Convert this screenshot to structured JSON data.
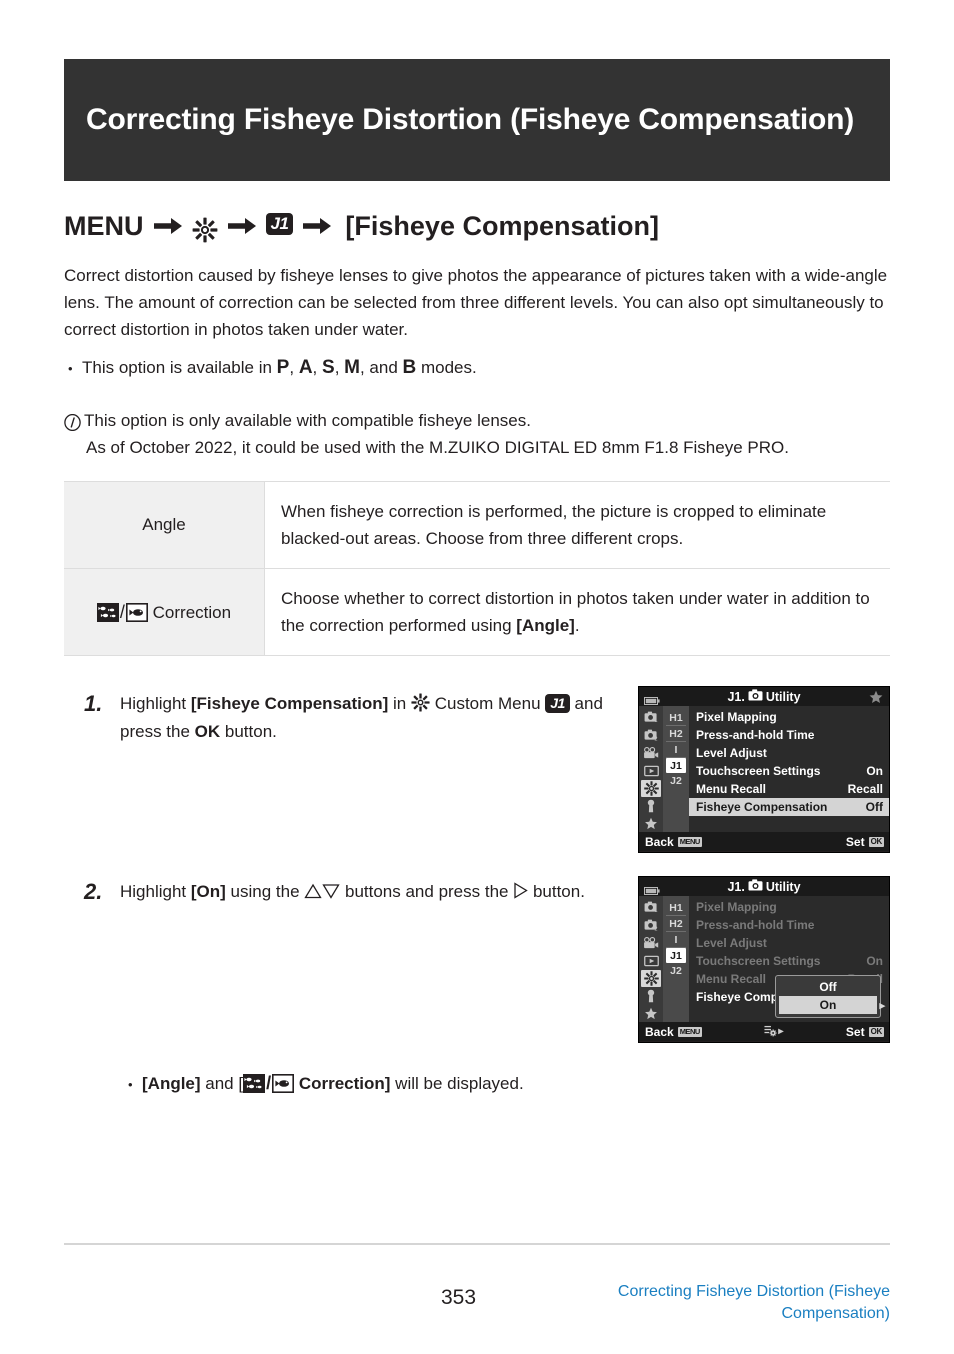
{
  "document": {
    "title": "Correcting Fisheye Distortion (Fisheye Compensation)",
    "page_number": "353"
  },
  "menu_path": {
    "menu_label": "MENU",
    "arrow": "→",
    "gear_icon": "gear-icon",
    "tab_badge": "J1",
    "target": "[Fisheye Compensation]"
  },
  "intro": {
    "paragraph": "Correct distortion caused by fisheye lenses to give photos the appearance of pictures taken with a wide-angle lens. The amount of correction can be selected from three different levels. You can also opt simultaneously to correct distortion in photos taken under water.",
    "bullet_prefix": "This option is available in ",
    "modes": [
      "P",
      "A",
      "S",
      "M",
      "B"
    ],
    "bullet_suffix": " modes.",
    "bullet_mid": ", and "
  },
  "note": {
    "icon": "info-icon",
    "line1": "This option is only available with compatible fisheye lenses.",
    "line2": "As of October 2022, it could be used with the M.ZUIKO DIGITAL ED 8mm F1.8 Fisheye PRO."
  },
  "table": {
    "rows": [
      {
        "label": "Angle",
        "has_icons": false,
        "description": "When fisheye correction is performed, the picture is cropped to eliminate blacked-out areas. Choose from three different crops."
      },
      {
        "label": "Correction",
        "has_icons": true,
        "icon_left": "fish-group-icon",
        "icon_right": "fish-underwater-icon",
        "description_pre": "Choose whether to correct distortion in photos taken under water in addition to the correction performed using ",
        "description_bold": "[Angle]",
        "description_post": "."
      }
    ]
  },
  "steps": [
    {
      "number": "1.",
      "text_parts": {
        "p1": "Highlight ",
        "b1": "[Fisheye Compensation]",
        "p2": " in ",
        "icon": "gear-icon",
        "p3": " Custom Menu ",
        "badge": "J1",
        "p4": " and press the ",
        "b2": "OK",
        "p5": " button."
      }
    },
    {
      "number": "2.",
      "text_parts": {
        "p1": "Highlight ",
        "b1": "[On]",
        "p2": " using the ",
        "icon_up": "triangle-up-icon",
        "icon_down": "triangle-down-icon",
        "p3": " buttons and press the ",
        "icon_right": "triangle-right-icon",
        "p4": " button."
      }
    }
  ],
  "sub_bullet": {
    "bold1": "[Angle]",
    "mid": " and [",
    "icon_left": "fish-group-icon",
    "icon_right": "fish-underwater-icon",
    "bold2": " Correction]",
    "tail": " will be displayed."
  },
  "lcd_screens": [
    {
      "id": "lcd-step-1",
      "titlebar": {
        "battery_icon": "battery-icon",
        "tab_number": "J1.",
        "camera_icon": "camera-icon",
        "title": "Utility",
        "star_icon": "star-icon"
      },
      "tabs": [
        {
          "icon": "camera-1-icon",
          "selected": false
        },
        {
          "icon": "camera-2-icon",
          "selected": false
        },
        {
          "icon": "movie-icon",
          "selected": false
        },
        {
          "icon": "playback-icon",
          "selected": false
        },
        {
          "icon": "gear-icon",
          "selected": true
        },
        {
          "icon": "wrench-icon",
          "selected": false
        },
        {
          "icon": "star-icon",
          "selected": false
        }
      ],
      "subtabs": [
        {
          "label": "H1",
          "selected": false
        },
        {
          "label": "H2",
          "selected": false
        },
        {
          "label": "I",
          "selected": false
        },
        {
          "label": "J1",
          "selected": true
        },
        {
          "label": "J2",
          "selected": false
        }
      ],
      "rows": [
        {
          "label": "Pixel Mapping",
          "value": "",
          "highlight": false,
          "dim": false
        },
        {
          "label": "Press-and-hold Time",
          "value": "",
          "highlight": false,
          "dim": false
        },
        {
          "label": "Level Adjust",
          "value": "",
          "highlight": false,
          "dim": false
        },
        {
          "label": "Touchscreen Settings",
          "value": "On",
          "highlight": false,
          "dim": false
        },
        {
          "label": "Menu Recall",
          "value": "Recall",
          "highlight": false,
          "dim": false
        },
        {
          "label": "Fisheye Compensation",
          "value": "Off",
          "highlight": true,
          "dim": false
        }
      ],
      "footer": {
        "back_label": "Back",
        "back_key": "MENU",
        "center": "",
        "set_label": "Set",
        "set_key": "OK"
      },
      "popup": null
    },
    {
      "id": "lcd-step-2",
      "titlebar": {
        "battery_icon": "battery-icon",
        "tab_number": "J1.",
        "camera_icon": "camera-icon",
        "title": "Utility",
        "star_icon": ""
      },
      "tabs": [
        {
          "icon": "camera-1-icon",
          "selected": false
        },
        {
          "icon": "camera-2-icon",
          "selected": false
        },
        {
          "icon": "movie-icon",
          "selected": false
        },
        {
          "icon": "playback-icon",
          "selected": false
        },
        {
          "icon": "gear-icon",
          "selected": true
        },
        {
          "icon": "wrench-icon",
          "selected": false
        },
        {
          "icon": "star-icon",
          "selected": false
        }
      ],
      "subtabs": [
        {
          "label": "H1",
          "selected": false
        },
        {
          "label": "H2",
          "selected": false
        },
        {
          "label": "I",
          "selected": false
        },
        {
          "label": "J1",
          "selected": true
        },
        {
          "label": "J2",
          "selected": false
        }
      ],
      "rows": [
        {
          "label": "Pixel Mapping",
          "value": "",
          "highlight": false,
          "dim": true
        },
        {
          "label": "Press-and-hold Time",
          "value": "",
          "highlight": false,
          "dim": true
        },
        {
          "label": "Level Adjust",
          "value": "",
          "highlight": false,
          "dim": true
        },
        {
          "label": "Touchscreen Settings",
          "value": "On",
          "highlight": false,
          "dim": true
        },
        {
          "label": "Menu Recall",
          "value": "Recall",
          "highlight": false,
          "dim": true
        },
        {
          "label": "Fisheye Compen",
          "value": "",
          "highlight": false,
          "dim": false
        }
      ],
      "footer": {
        "back_label": "Back",
        "back_key": "MENU",
        "center": "menu-gear-icon",
        "set_label": "Set",
        "set_key": "OK"
      },
      "popup": {
        "items": [
          {
            "label": "Off",
            "selected": false
          },
          {
            "label": "On",
            "selected": true
          }
        ]
      }
    }
  ],
  "footer": {
    "page_number": "353",
    "link_line1": "Correcting Fisheye Distortion (Fisheye",
    "link_line2": "Compensation)",
    "link_color": "#1a7fc1"
  }
}
